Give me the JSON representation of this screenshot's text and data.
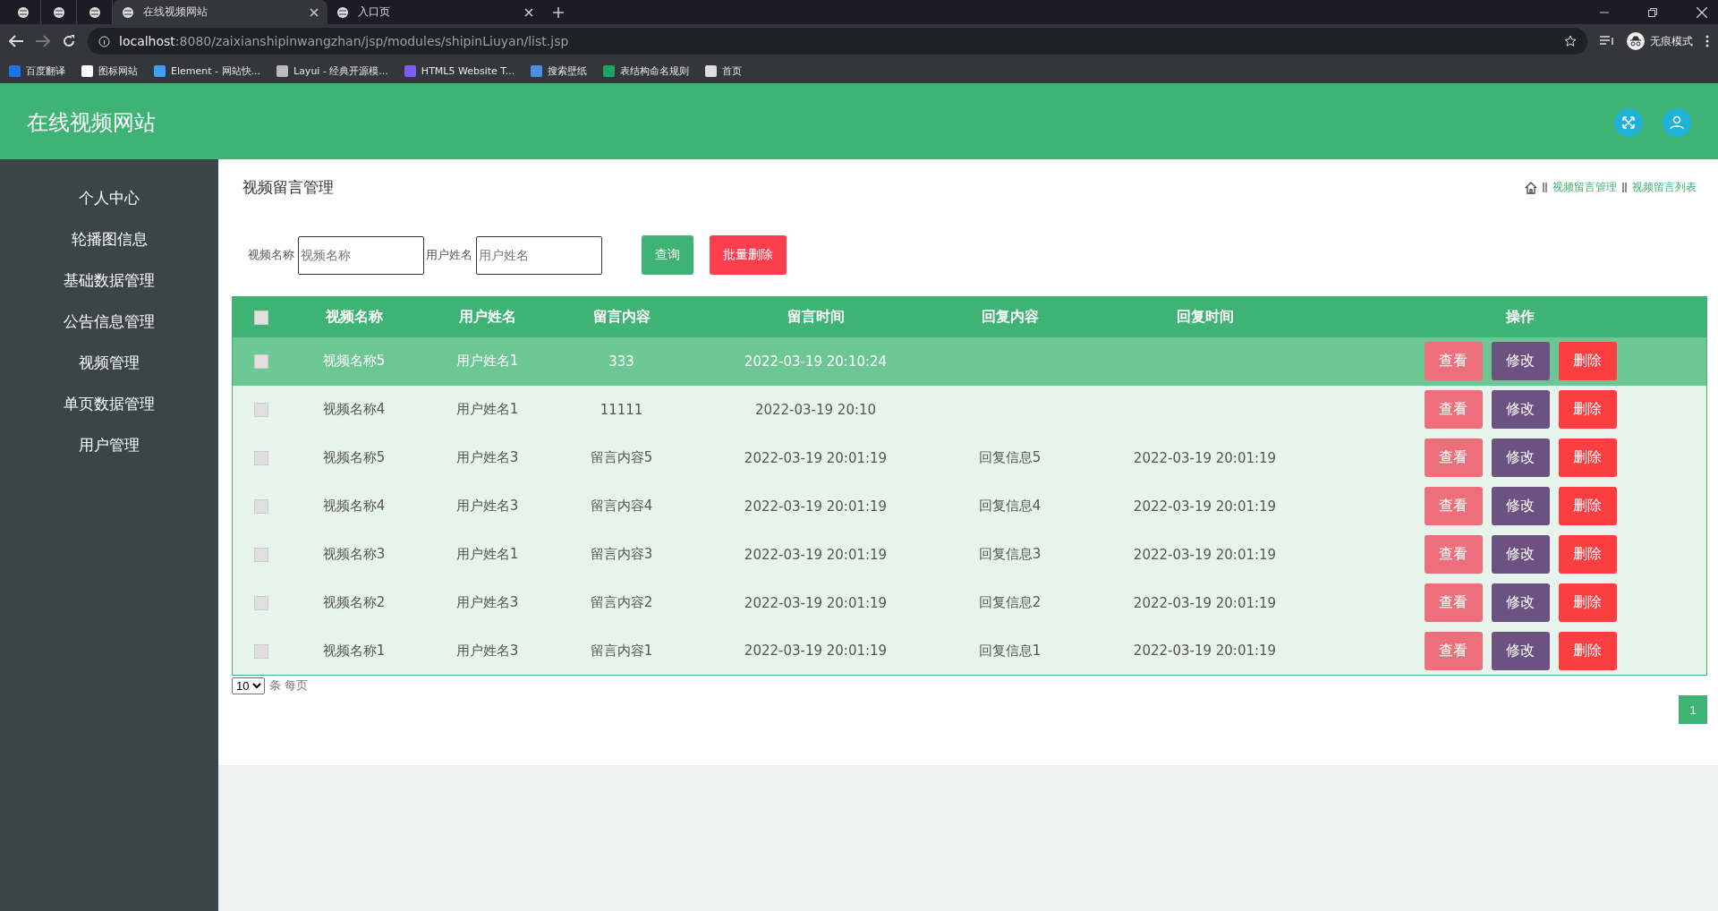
{
  "browser": {
    "tabs": [
      {
        "kind": "icon",
        "selected": false
      },
      {
        "kind": "icon",
        "selected": false
      },
      {
        "kind": "icon",
        "selected": false
      },
      {
        "kind": "page",
        "title": "在线视频网站",
        "selected": true
      },
      {
        "kind": "page",
        "title": "入口页",
        "selected": false
      }
    ],
    "url_host": "localhost",
    "url_rest": ":8080/zaixianshipinwangzhan/jsp/modules/shipinLiuyan/list.jsp",
    "incognito": "无痕模式",
    "bookmarks": [
      "百度翻译",
      "图标网站",
      "Element - 网站快...",
      "Layui - 经典开源模...",
      "HTML5 Website T...",
      "搜索壁纸",
      "表结构命名规则",
      "首页"
    ]
  },
  "header": {
    "title": "在线视频网站"
  },
  "sidebar": {
    "items": [
      "个人中心",
      "轮播图信息",
      "基础数据管理",
      "公告信息管理",
      "视频管理",
      "单页数据管理",
      "用户管理"
    ]
  },
  "page": {
    "title": "视频留言管理",
    "breadcrumb": [
      "视频留言管理",
      "视频留言列表"
    ]
  },
  "search": {
    "fields": [
      {
        "label": "视频名称",
        "placeholder": "视频名称"
      },
      {
        "label": "用户姓名",
        "placeholder": "用户姓名"
      }
    ],
    "query_button": "查询",
    "batch_delete_button": "批量删除"
  },
  "table": {
    "header_checked": false,
    "columns": [
      "视频名称",
      "用户姓名",
      "留言内容",
      "留言时间",
      "回复内容",
      "回复时间",
      "操作"
    ],
    "rows": [
      {
        "selected": true,
        "checked": false,
        "cells": [
          "视频名称5",
          "用户姓名1",
          "333",
          "2022-03-19 20:10:24",
          "",
          ""
        ],
        "actions": [
          "查看",
          "修改",
          "删除"
        ]
      },
      {
        "selected": false,
        "checked": false,
        "cells": [
          "视频名称4",
          "用户姓名1",
          "11111",
          "2022-03-19 20:10",
          "",
          ""
        ],
        "actions": [
          "查看",
          "修改",
          "删除"
        ]
      },
      {
        "selected": false,
        "checked": false,
        "cells": [
          "视频名称5",
          "用户姓名3",
          "留言内容5",
          "2022-03-19 20:01:19",
          "回复信息5",
          "2022-03-19 20:01:19"
        ],
        "actions": [
          "查看",
          "修改",
          "删除"
        ]
      },
      {
        "selected": false,
        "checked": false,
        "cells": [
          "视频名称4",
          "用户姓名3",
          "留言内容4",
          "2022-03-19 20:01:19",
          "回复信息4",
          "2022-03-19 20:01:19"
        ],
        "actions": [
          "查看",
          "修改",
          "删除"
        ]
      },
      {
        "selected": false,
        "checked": false,
        "cells": [
          "视频名称3",
          "用户姓名1",
          "留言内容3",
          "2022-03-19 20:01:19",
          "回复信息3",
          "2022-03-19 20:01:19"
        ],
        "actions": [
          "查看",
          "修改",
          "删除"
        ]
      },
      {
        "selected": false,
        "checked": false,
        "cells": [
          "视频名称2",
          "用户姓名3",
          "留言内容2",
          "2022-03-19 20:01:19",
          "回复信息2",
          "2022-03-19 20:01:19"
        ],
        "actions": [
          "查看",
          "修改",
          "删除"
        ]
      },
      {
        "selected": false,
        "checked": false,
        "cells": [
          "视频名称1",
          "用户姓名3",
          "留言内容1",
          "2022-03-19 20:01:19",
          "回复信息1",
          "2022-03-19 20:01:19"
        ],
        "actions": [
          "查看",
          "修改",
          "删除"
        ]
      }
    ]
  },
  "pagination": {
    "page_size": "10",
    "page_size_label": "条 每页",
    "pages": [
      {
        "label": "1",
        "selected": true
      }
    ]
  }
}
